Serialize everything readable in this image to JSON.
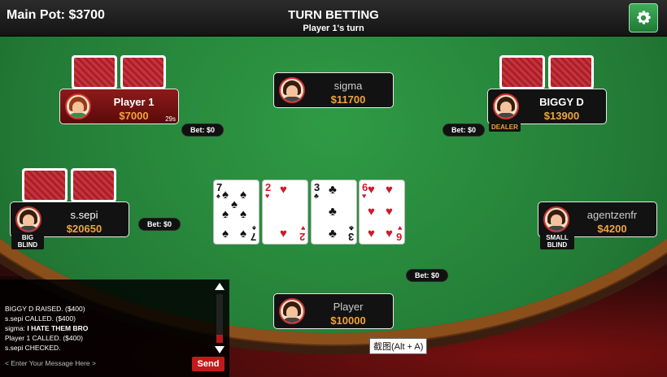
{
  "header": {
    "main_pot": "Main Pot: $3700",
    "title": "TURN BETTING",
    "subtitle": "Player 1's turn",
    "settings_icon": "gear-icon"
  },
  "players": {
    "player1": {
      "name": "Player 1",
      "chips": "$7000",
      "timer": "29s",
      "bet": "Bet: $0"
    },
    "sigma": {
      "name": "sigma",
      "chips": "$11700"
    },
    "biggy": {
      "name": "BIGGY D",
      "chips": "$13900",
      "bet": "Bet: $0",
      "tag": "DEALER"
    },
    "ssepi": {
      "name": "s.sepi",
      "chips": "$20650",
      "bet": "Bet: $0",
      "tag": "BIG BLIND"
    },
    "agent": {
      "name": "agentzenfr",
      "chips": "$4200",
      "tag": "SMALL BLIND"
    },
    "player": {
      "name": "Player",
      "chips": "$10000",
      "bet": "Bet: $0"
    }
  },
  "community_cards": [
    {
      "rank": "7",
      "suit": "♠",
      "color": "black"
    },
    {
      "rank": "2",
      "suit": "♥",
      "color": "red"
    },
    {
      "rank": "3",
      "suit": "♣",
      "color": "black"
    },
    {
      "rank": "6",
      "suit": "♥",
      "color": "red"
    }
  ],
  "chat": {
    "lines": [
      {
        "who": "",
        "text": "BIGGY D RAISED. ($400)"
      },
      {
        "who": "",
        "text": "s.sepi CALLED. ($400)"
      },
      {
        "who": "sigma:",
        "text": "I HATE THEM BRO"
      },
      {
        "who": "",
        "text": "Player 1 CALLED. ($400)"
      },
      {
        "who": "",
        "text": "s.sepi CHECKED."
      }
    ],
    "placeholder": "< Enter Your Message Here >",
    "send_label": "Send"
  },
  "tooltip": "截图(Alt + A)",
  "colors": {
    "felt": "#237c36",
    "chips_text": "#f0a33c",
    "active_seat": "#8e1a1a",
    "send": "#c21a1a"
  }
}
